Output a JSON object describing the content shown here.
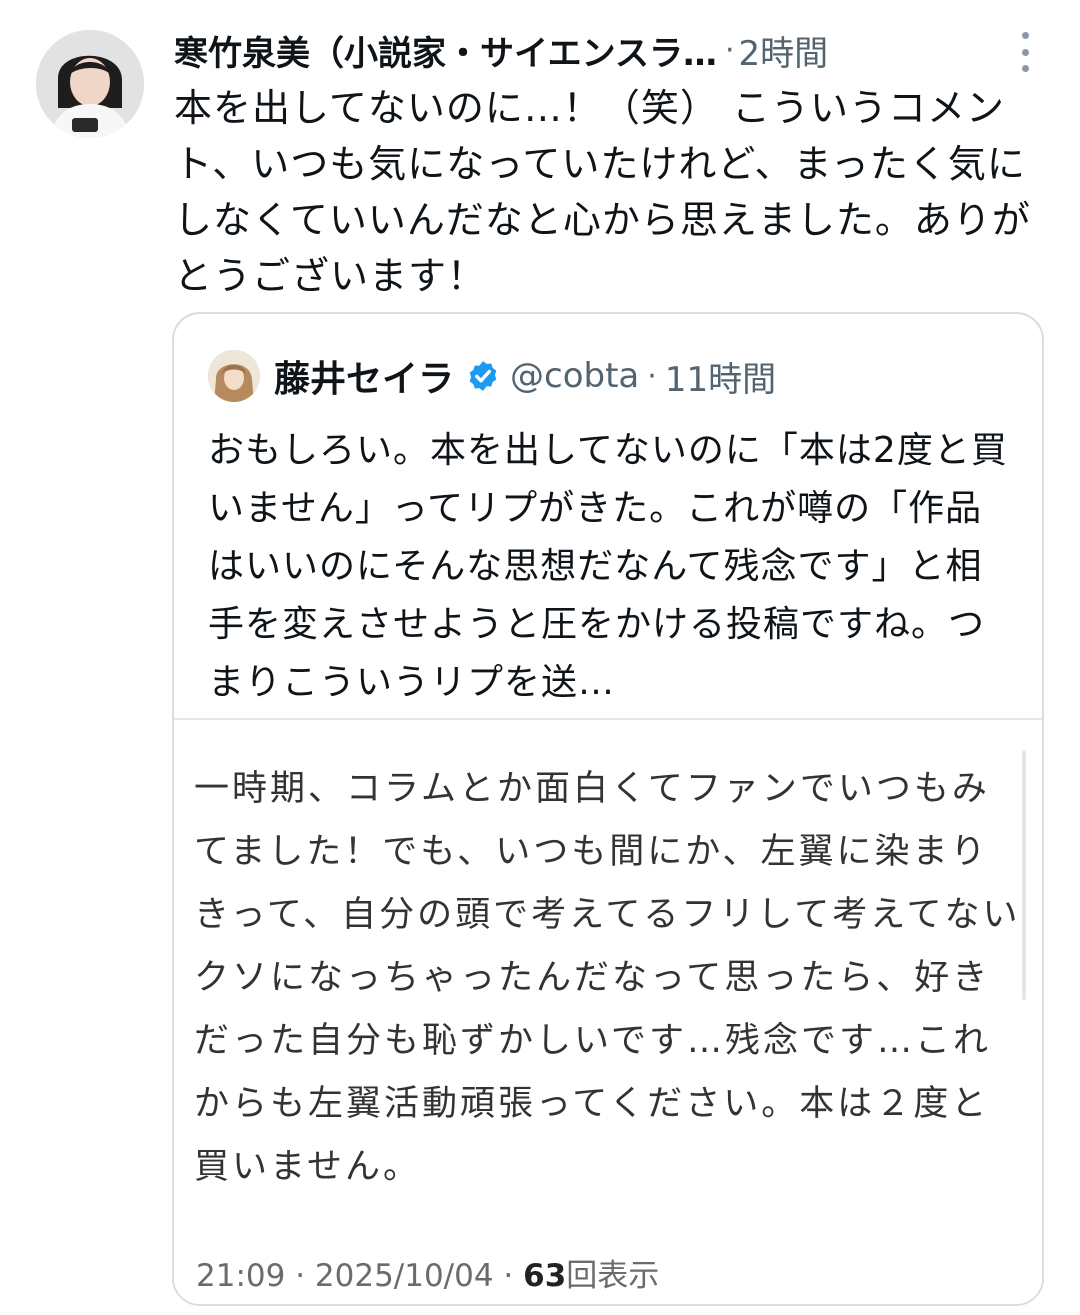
{
  "tweet": {
    "author_name": "寒竹泉美（小説家・サイエンスラ…",
    "separator": "·",
    "time_ago": "2時間",
    "text": "本を出してないのに…！（笑） こういうコメント、いつも気になっていたけれど、まったく気にしなくていいんだなと心から思えました。ありがとうございます！"
  },
  "quoted_tweet": {
    "author_name": "藤井セイラ",
    "handle": "@cobta",
    "separator": "·",
    "time_ago": "11時間",
    "text": "おもしろい。本を出してないのに「本は2度と買いません」ってリプがきた。これが噂の「作品はいいのにそんな思想だなんて残念です」と相手を変えさせようと圧をかける投稿ですね。つまりこういうリプを送…"
  },
  "media": {
    "text": "一時期、コラムとか面白くてファンでいつもみてました！でも、いつも間にか、左翼に染まりきって、自分の頭で考えてるフリして考えてないクソになっちゃったんだなって思ったら、好きだった自分も恥ずかしいです…残念です…これからも左翼活動頑張ってください。本は２度と買いません。",
    "timestamp": "21:09 · 2025/10/04 · ",
    "views_count": "63",
    "views_label": "回表示"
  },
  "icons": {
    "more": "more-vertical-icon",
    "verified": "verified-badge-icon"
  },
  "colors": {
    "text_primary": "#0f1419",
    "text_secondary": "#536471",
    "verified_blue": "#1d9bf0",
    "card_border": "#d7dde2"
  }
}
